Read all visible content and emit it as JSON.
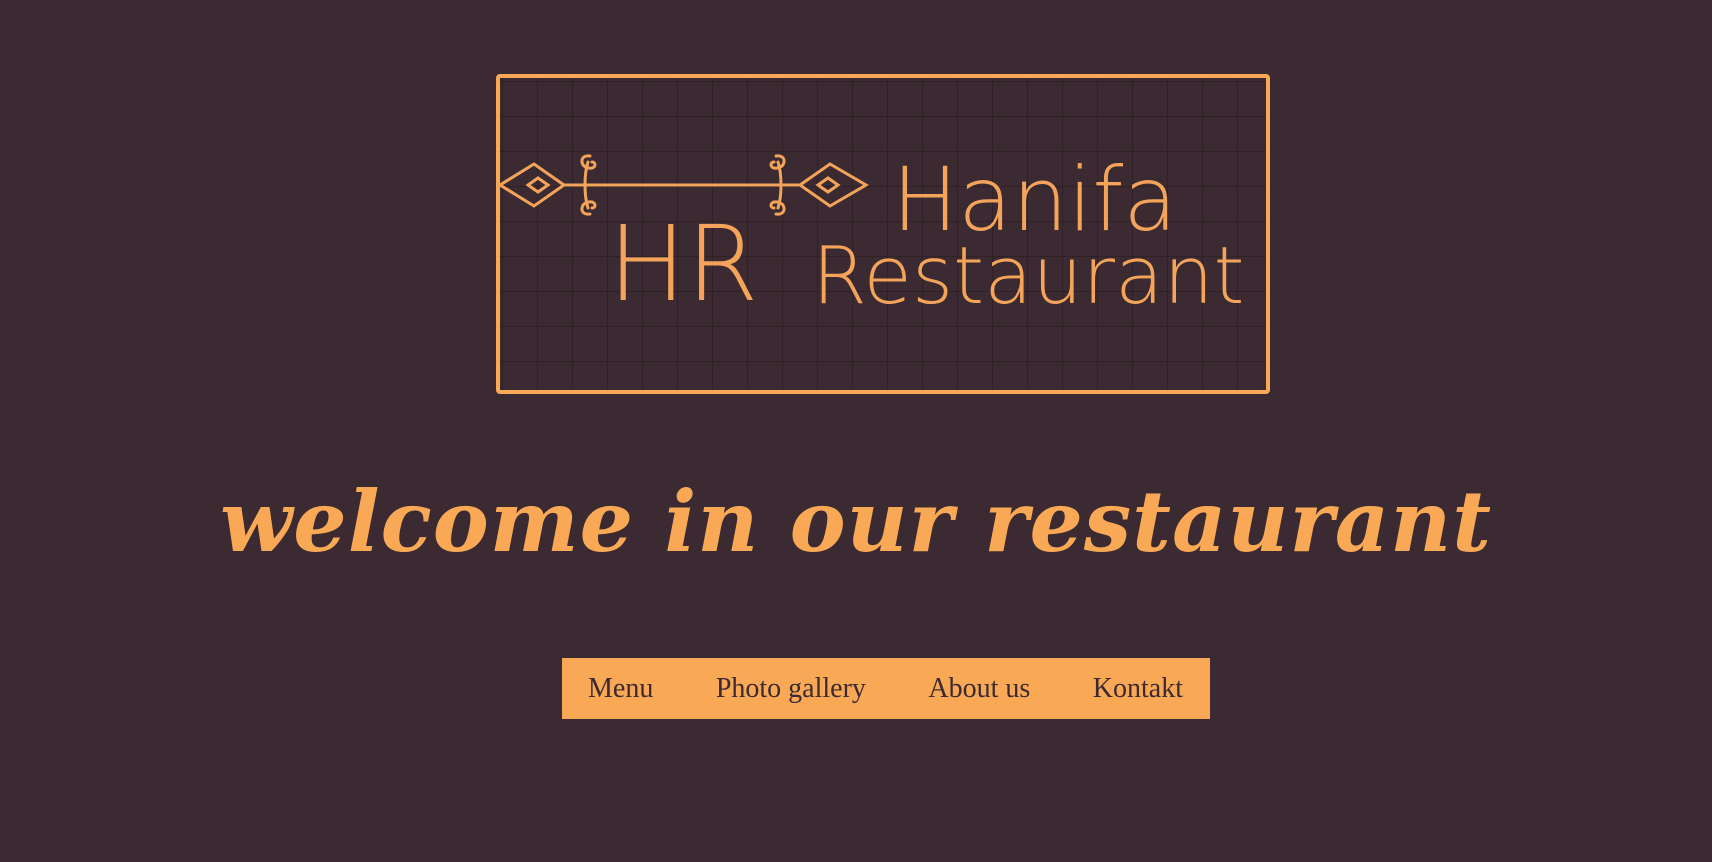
{
  "logo": {
    "monogram": "HR",
    "name_line1": "Hanifa",
    "name_line2": "Restaurant"
  },
  "welcome": {
    "heading": "welcome in our restaurant"
  },
  "nav": {
    "items": [
      {
        "label": "Menu"
      },
      {
        "label": "Photo gallery"
      },
      {
        "label": "About us"
      },
      {
        "label": "Kontakt"
      }
    ]
  },
  "colors": {
    "background": "#3b2a31",
    "accent": "#f9a956"
  }
}
